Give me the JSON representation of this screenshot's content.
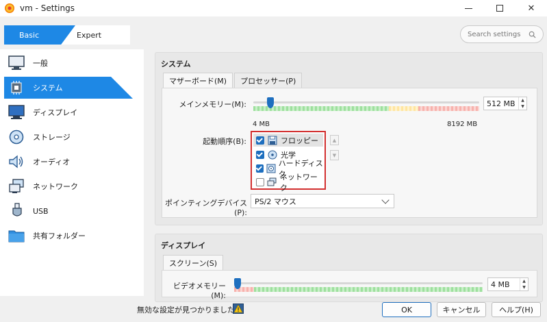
{
  "window": {
    "title": "vm - Settings"
  },
  "mode": {
    "basic": "Basic",
    "expert": "Expert"
  },
  "search": {
    "placeholder": "Search settings"
  },
  "sidebar": {
    "items": [
      {
        "label": "一般",
        "icon": "monitor-icon"
      },
      {
        "label": "システム",
        "icon": "chip-icon"
      },
      {
        "label": "ディスプレイ",
        "icon": "display-icon"
      },
      {
        "label": "ストレージ",
        "icon": "disk-icon"
      },
      {
        "label": "オーディオ",
        "icon": "speaker-icon"
      },
      {
        "label": "ネットワーク",
        "icon": "network-icon"
      },
      {
        "label": "USB",
        "icon": "usb-icon"
      },
      {
        "label": "共有フォルダー",
        "icon": "folder-icon"
      }
    ]
  },
  "system": {
    "title": "システム",
    "tabs": [
      "マザーボード(M)",
      "プロセッサー(P)"
    ],
    "memory": {
      "label": "メインメモリー(M):",
      "value": "512 MB",
      "min": "4 MB",
      "max": "8192 MB",
      "fraction": 0.062
    },
    "boot": {
      "label": "起動順序(B):",
      "items": [
        {
          "label": "フロッピー",
          "checked": true,
          "icon": "floppy-icon"
        },
        {
          "label": "光学",
          "checked": true,
          "icon": "optical-disc-icon"
        },
        {
          "label": "ハードディスク",
          "checked": true,
          "icon": "hard-disk-icon"
        },
        {
          "label": "ネットワーク",
          "checked": false,
          "icon": "network-icon"
        }
      ]
    },
    "pointing": {
      "label": "ポインティングデバイス(P):",
      "value": "PS/2 マウス"
    }
  },
  "display": {
    "title": "ディスプレイ",
    "tabs": [
      "スクリーン(S)"
    ],
    "video_memory": {
      "label": "ビデオメモリー(M):",
      "value": "4 MB",
      "fraction": 0.0
    }
  },
  "footer": {
    "message": "無効な設定が見つかりました",
    "ok": "OK",
    "cancel": "キャンセル",
    "help": "ヘルプ(H)"
  },
  "colors": {
    "accent": "#1e88e5",
    "boot_highlight": "#d32f2f"
  }
}
